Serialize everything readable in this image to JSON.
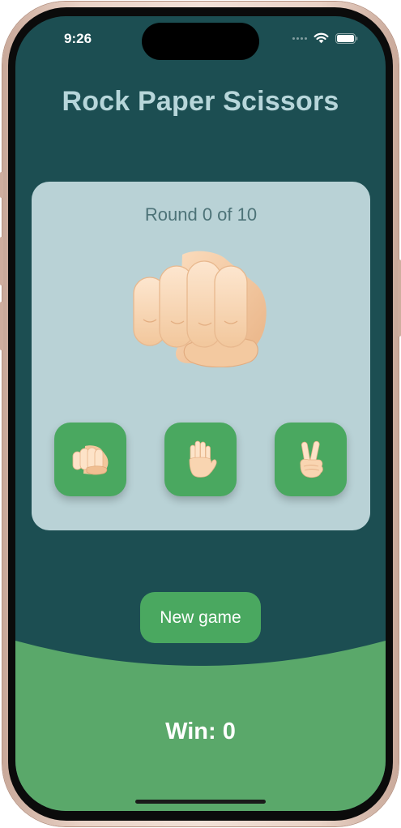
{
  "status_bar": {
    "time": "9:26",
    "icons": [
      "cellular-signal-icon",
      "wifi-icon",
      "battery-icon"
    ]
  },
  "app": {
    "title": "Rock Paper Scissors",
    "round_label": "Round 0 of 10",
    "current_move_icon": "fist-icon",
    "choices": [
      {
        "name": "rock",
        "icon": "fist-icon"
      },
      {
        "name": "paper",
        "icon": "raised-hand-icon"
      },
      {
        "name": "scissors",
        "icon": "victory-hand-icon"
      }
    ],
    "new_game_label": "New game",
    "score_label": "Win: 0"
  },
  "colors": {
    "background": "#1c4e52",
    "card": "#b9d2d6",
    "accent_green": "#4aa860",
    "bottom_green": "#5aa86a",
    "title_text": "#b7d6da"
  }
}
